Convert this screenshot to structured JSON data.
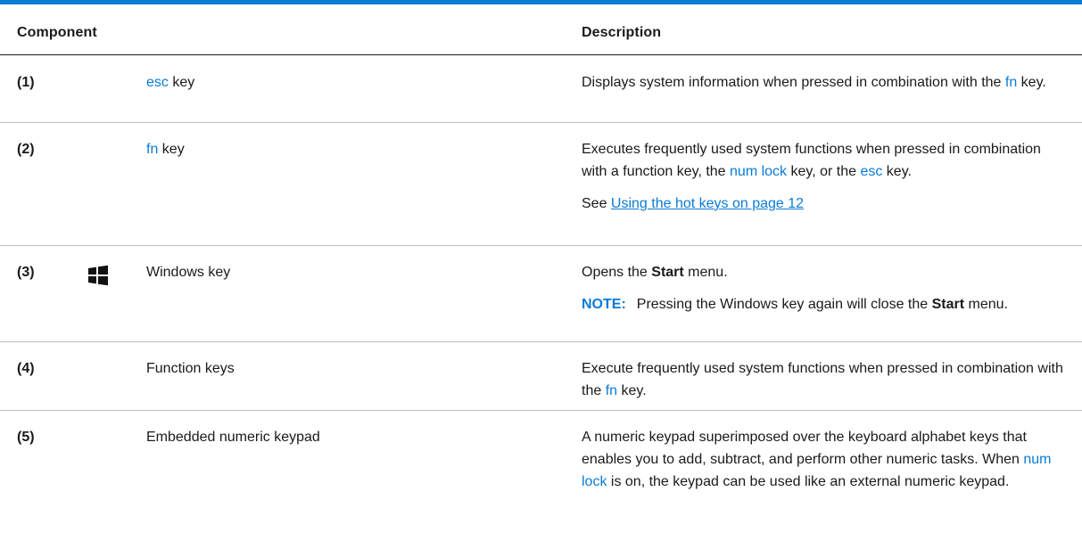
{
  "header": {
    "component": "Component",
    "description": "Description"
  },
  "rows": [
    {
      "num": "(1)",
      "name_key": "esc",
      "name_suffix": " key",
      "desc": {
        "a": "Displays system information when pressed in combination with the ",
        "key": "fn",
        "b": " key."
      }
    },
    {
      "num": "(2)",
      "name_key": "fn",
      "name_suffix": " key",
      "desc": {
        "a": "Executes frequently used system functions when pressed in combination with a function key, the ",
        "key1": "num lock",
        "b": " key, or the ",
        "key2": "esc",
        "c": " key."
      },
      "see_prefix": "See ",
      "see_link": "Using the hot keys on page 12"
    },
    {
      "num": "(3)",
      "icon": "windows-logo-icon",
      "name": "Windows key",
      "desc": {
        "a": "Opens the ",
        "bold": "Start",
        "b": " menu."
      },
      "note": {
        "label": "NOTE:",
        "a": "Pressing the Windows key again will close the ",
        "bold": "Start",
        "b": " menu."
      }
    },
    {
      "num": "(4)",
      "name": "Function keys",
      "desc": {
        "a": "Execute frequently used system functions when pressed in combination with the ",
        "key": "fn",
        "b": " key."
      }
    },
    {
      "num": "(5)",
      "name": "Embedded numeric keypad",
      "desc": {
        "a": "A numeric keypad superimposed over the keyboard alphabet keys that enables you to add, subtract, and perform other numeric tasks. When ",
        "key": "num lock",
        "b": " is on, the keypad can be used like an external numeric keypad."
      }
    }
  ],
  "colors": {
    "accent": "#0a7bd7",
    "text": "#1a1a1a",
    "rule": "#bdbdbd"
  }
}
